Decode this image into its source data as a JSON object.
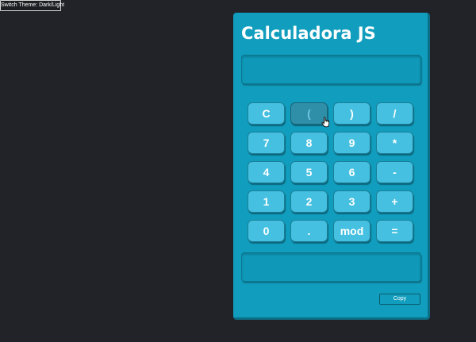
{
  "theme_toggle": {
    "label": "Switch Theme: Dark/Light"
  },
  "calculator": {
    "title": "Calculadora JS",
    "expression": "",
    "result": "",
    "keys": [
      {
        "label": "C",
        "name": "key-clear"
      },
      {
        "label": "(",
        "name": "key-open-paren"
      },
      {
        "label": ")",
        "name": "key-close-paren"
      },
      {
        "label": "/",
        "name": "key-divide"
      },
      {
        "label": "7",
        "name": "key-7"
      },
      {
        "label": "8",
        "name": "key-8"
      },
      {
        "label": "9",
        "name": "key-9"
      },
      {
        "label": "*",
        "name": "key-multiply"
      },
      {
        "label": "4",
        "name": "key-4"
      },
      {
        "label": "5",
        "name": "key-5"
      },
      {
        "label": "6",
        "name": "key-6"
      },
      {
        "label": "-",
        "name": "key-subtract"
      },
      {
        "label": "1",
        "name": "key-1"
      },
      {
        "label": "2",
        "name": "key-2"
      },
      {
        "label": "3",
        "name": "key-3"
      },
      {
        "label": "+",
        "name": "key-add"
      },
      {
        "label": "0",
        "name": "key-0"
      },
      {
        "label": ".",
        "name": "key-decimal"
      },
      {
        "label": "mod",
        "name": "key-mod"
      },
      {
        "label": "=",
        "name": "key-equals"
      }
    ],
    "copy_label": "Copy"
  },
  "state": {
    "hovered_key": "("
  },
  "colors": {
    "page_background": "#212328",
    "calculator_background": "#119dbd",
    "key_background": "#45c0e0",
    "key_hover_background": "#2f8fa8"
  },
  "icons": {
    "pointer": "hand-pointer-icon"
  }
}
